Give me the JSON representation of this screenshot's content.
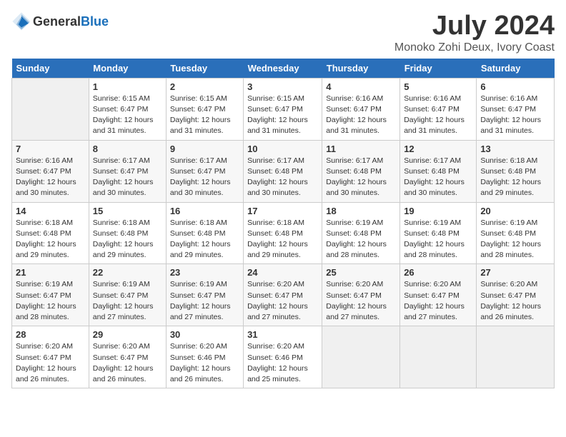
{
  "header": {
    "logo_general": "General",
    "logo_blue": "Blue",
    "month_title": "July 2024",
    "location": "Monoko Zohi Deux, Ivory Coast"
  },
  "days_of_week": [
    "Sunday",
    "Monday",
    "Tuesday",
    "Wednesday",
    "Thursday",
    "Friday",
    "Saturday"
  ],
  "weeks": [
    [
      {
        "day": "",
        "info": ""
      },
      {
        "day": "1",
        "info": "Sunrise: 6:15 AM\nSunset: 6:47 PM\nDaylight: 12 hours\nand 31 minutes."
      },
      {
        "day": "2",
        "info": "Sunrise: 6:15 AM\nSunset: 6:47 PM\nDaylight: 12 hours\nand 31 minutes."
      },
      {
        "day": "3",
        "info": "Sunrise: 6:15 AM\nSunset: 6:47 PM\nDaylight: 12 hours\nand 31 minutes."
      },
      {
        "day": "4",
        "info": "Sunrise: 6:16 AM\nSunset: 6:47 PM\nDaylight: 12 hours\nand 31 minutes."
      },
      {
        "day": "5",
        "info": "Sunrise: 6:16 AM\nSunset: 6:47 PM\nDaylight: 12 hours\nand 31 minutes."
      },
      {
        "day": "6",
        "info": "Sunrise: 6:16 AM\nSunset: 6:47 PM\nDaylight: 12 hours\nand 31 minutes."
      }
    ],
    [
      {
        "day": "7",
        "info": "Sunrise: 6:16 AM\nSunset: 6:47 PM\nDaylight: 12 hours\nand 30 minutes."
      },
      {
        "day": "8",
        "info": "Sunrise: 6:17 AM\nSunset: 6:47 PM\nDaylight: 12 hours\nand 30 minutes."
      },
      {
        "day": "9",
        "info": "Sunrise: 6:17 AM\nSunset: 6:47 PM\nDaylight: 12 hours\nand 30 minutes."
      },
      {
        "day": "10",
        "info": "Sunrise: 6:17 AM\nSunset: 6:48 PM\nDaylight: 12 hours\nand 30 minutes."
      },
      {
        "day": "11",
        "info": "Sunrise: 6:17 AM\nSunset: 6:48 PM\nDaylight: 12 hours\nand 30 minutes."
      },
      {
        "day": "12",
        "info": "Sunrise: 6:17 AM\nSunset: 6:48 PM\nDaylight: 12 hours\nand 30 minutes."
      },
      {
        "day": "13",
        "info": "Sunrise: 6:18 AM\nSunset: 6:48 PM\nDaylight: 12 hours\nand 29 minutes."
      }
    ],
    [
      {
        "day": "14",
        "info": "Sunrise: 6:18 AM\nSunset: 6:48 PM\nDaylight: 12 hours\nand 29 minutes."
      },
      {
        "day": "15",
        "info": "Sunrise: 6:18 AM\nSunset: 6:48 PM\nDaylight: 12 hours\nand 29 minutes."
      },
      {
        "day": "16",
        "info": "Sunrise: 6:18 AM\nSunset: 6:48 PM\nDaylight: 12 hours\nand 29 minutes."
      },
      {
        "day": "17",
        "info": "Sunrise: 6:18 AM\nSunset: 6:48 PM\nDaylight: 12 hours\nand 29 minutes."
      },
      {
        "day": "18",
        "info": "Sunrise: 6:19 AM\nSunset: 6:48 PM\nDaylight: 12 hours\nand 28 minutes."
      },
      {
        "day": "19",
        "info": "Sunrise: 6:19 AM\nSunset: 6:48 PM\nDaylight: 12 hours\nand 28 minutes."
      },
      {
        "day": "20",
        "info": "Sunrise: 6:19 AM\nSunset: 6:48 PM\nDaylight: 12 hours\nand 28 minutes."
      }
    ],
    [
      {
        "day": "21",
        "info": "Sunrise: 6:19 AM\nSunset: 6:47 PM\nDaylight: 12 hours\nand 28 minutes."
      },
      {
        "day": "22",
        "info": "Sunrise: 6:19 AM\nSunset: 6:47 PM\nDaylight: 12 hours\nand 27 minutes."
      },
      {
        "day": "23",
        "info": "Sunrise: 6:19 AM\nSunset: 6:47 PM\nDaylight: 12 hours\nand 27 minutes."
      },
      {
        "day": "24",
        "info": "Sunrise: 6:20 AM\nSunset: 6:47 PM\nDaylight: 12 hours\nand 27 minutes."
      },
      {
        "day": "25",
        "info": "Sunrise: 6:20 AM\nSunset: 6:47 PM\nDaylight: 12 hours\nand 27 minutes."
      },
      {
        "day": "26",
        "info": "Sunrise: 6:20 AM\nSunset: 6:47 PM\nDaylight: 12 hours\nand 27 minutes."
      },
      {
        "day": "27",
        "info": "Sunrise: 6:20 AM\nSunset: 6:47 PM\nDaylight: 12 hours\nand 26 minutes."
      }
    ],
    [
      {
        "day": "28",
        "info": "Sunrise: 6:20 AM\nSunset: 6:47 PM\nDaylight: 12 hours\nand 26 minutes."
      },
      {
        "day": "29",
        "info": "Sunrise: 6:20 AM\nSunset: 6:47 PM\nDaylight: 12 hours\nand 26 minutes."
      },
      {
        "day": "30",
        "info": "Sunrise: 6:20 AM\nSunset: 6:46 PM\nDaylight: 12 hours\nand 26 minutes."
      },
      {
        "day": "31",
        "info": "Sunrise: 6:20 AM\nSunset: 6:46 PM\nDaylight: 12 hours\nand 25 minutes."
      },
      {
        "day": "",
        "info": ""
      },
      {
        "day": "",
        "info": ""
      },
      {
        "day": "",
        "info": ""
      }
    ]
  ]
}
